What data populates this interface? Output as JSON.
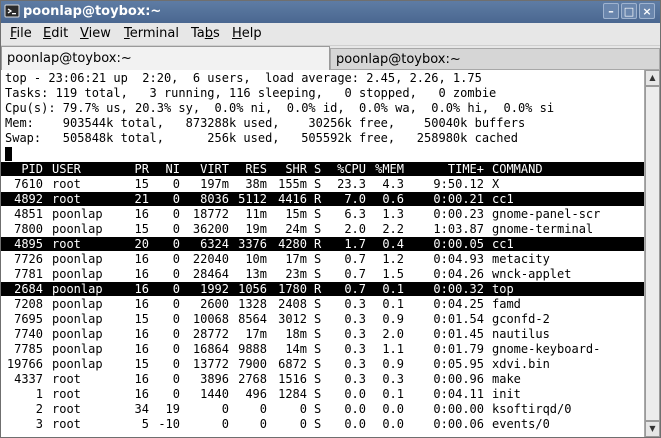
{
  "window": {
    "title": "poonlap@toybox:~",
    "minimize_glyph": "–",
    "maximize_glyph": "□",
    "close_glyph": "×"
  },
  "menu": {
    "file": {
      "label": "File",
      "accel": "F",
      "rest": "ile"
    },
    "edit": {
      "label": "Edit",
      "accel": "E",
      "rest": "dit"
    },
    "view": {
      "label": "View",
      "accel": "V",
      "rest": "iew"
    },
    "terminal": {
      "label": "Terminal",
      "accel": "T",
      "rest": "erminal"
    },
    "tabs": {
      "label": "Tabs",
      "pre": "Ta",
      "accel": "b",
      "rest": "s"
    },
    "help": {
      "label": "Help",
      "accel": "H",
      "rest": "elp"
    }
  },
  "tabs": [
    {
      "label": "poonlap@toybox:~",
      "active": true
    },
    {
      "label": "poonlap@toybox:~",
      "active": false
    }
  ],
  "top": {
    "summary": [
      "top - 23:06:21 up  2:20,  6 users,  load average: 2.45, 2.26, 1.75",
      "Tasks: 119 total,   3 running, 116 sleeping,   0 stopped,   0 zombie",
      "Cpu(s): 79.7% us, 20.3% sy,  0.0% ni,  0.0% id,  0.0% wa,  0.0% hi,  0.0% si",
      "Mem:    903544k total,   873288k used,    30256k free,    50040k buffers",
      "Swap:   505848k total,      256k used,   505592k free,   258980k cached"
    ],
    "columns": [
      "PID",
      "USER",
      "PR",
      "NI",
      "VIRT",
      "RES",
      "SHR",
      "S",
      "%CPU",
      "%MEM",
      "TIME+",
      "COMMAND"
    ],
    "processes": [
      {
        "pid": "7610",
        "user": "root",
        "pr": "15",
        "ni": "0",
        "virt": "197m",
        "res": "38m",
        "shr": "155m",
        "s": "S",
        "cpu": "23.3",
        "mem": "4.3",
        "time": "9:50.12",
        "cmd": "X",
        "hl": false
      },
      {
        "pid": "4892",
        "user": "root",
        "pr": "21",
        "ni": "0",
        "virt": "8036",
        "res": "5112",
        "shr": "4416",
        "s": "R",
        "cpu": "7.0",
        "mem": "0.6",
        "time": "0:00.21",
        "cmd": "cc1",
        "hl": true
      },
      {
        "pid": "4851",
        "user": "poonlap",
        "pr": "16",
        "ni": "0",
        "virt": "18772",
        "res": "11m",
        "shr": "15m",
        "s": "S",
        "cpu": "6.3",
        "mem": "1.3",
        "time": "0:00.23",
        "cmd": "gnome-panel-scr",
        "hl": false
      },
      {
        "pid": "7800",
        "user": "poonlap",
        "pr": "15",
        "ni": "0",
        "virt": "36200",
        "res": "19m",
        "shr": "24m",
        "s": "S",
        "cpu": "2.0",
        "mem": "2.2",
        "time": "1:03.87",
        "cmd": "gnome-terminal",
        "hl": false
      },
      {
        "pid": "4895",
        "user": "root",
        "pr": "20",
        "ni": "0",
        "virt": "6324",
        "res": "3376",
        "shr": "4280",
        "s": "R",
        "cpu": "1.7",
        "mem": "0.4",
        "time": "0:00.05",
        "cmd": "cc1",
        "hl": true
      },
      {
        "pid": "7726",
        "user": "poonlap",
        "pr": "16",
        "ni": "0",
        "virt": "22040",
        "res": "10m",
        "shr": "17m",
        "s": "S",
        "cpu": "0.7",
        "mem": "1.2",
        "time": "0:04.93",
        "cmd": "metacity",
        "hl": false
      },
      {
        "pid": "7781",
        "user": "poonlap",
        "pr": "16",
        "ni": "0",
        "virt": "28464",
        "res": "13m",
        "shr": "23m",
        "s": "S",
        "cpu": "0.7",
        "mem": "1.5",
        "time": "0:04.26",
        "cmd": "wnck-applet",
        "hl": false
      },
      {
        "pid": "2684",
        "user": "poonlap",
        "pr": "16",
        "ni": "0",
        "virt": "1992",
        "res": "1056",
        "shr": "1780",
        "s": "R",
        "cpu": "0.7",
        "mem": "0.1",
        "time": "0:00.32",
        "cmd": "top",
        "hl": true
      },
      {
        "pid": "7208",
        "user": "poonlap",
        "pr": "16",
        "ni": "0",
        "virt": "2600",
        "res": "1328",
        "shr": "2408",
        "s": "S",
        "cpu": "0.3",
        "mem": "0.1",
        "time": "0:04.25",
        "cmd": "famd",
        "hl": false
      },
      {
        "pid": "7695",
        "user": "poonlap",
        "pr": "15",
        "ni": "0",
        "virt": "10068",
        "res": "8564",
        "shr": "3012",
        "s": "S",
        "cpu": "0.3",
        "mem": "0.9",
        "time": "0:01.54",
        "cmd": "gconfd-2",
        "hl": false
      },
      {
        "pid": "7740",
        "user": "poonlap",
        "pr": "16",
        "ni": "0",
        "virt": "28772",
        "res": "17m",
        "shr": "18m",
        "s": "S",
        "cpu": "0.3",
        "mem": "2.0",
        "time": "0:01.45",
        "cmd": "nautilus",
        "hl": false
      },
      {
        "pid": "7785",
        "user": "poonlap",
        "pr": "16",
        "ni": "0",
        "virt": "16864",
        "res": "9888",
        "shr": "14m",
        "s": "S",
        "cpu": "0.3",
        "mem": "1.1",
        "time": "0:01.79",
        "cmd": "gnome-keyboard-",
        "hl": false
      },
      {
        "pid": "19766",
        "user": "poonlap",
        "pr": "15",
        "ni": "0",
        "virt": "13772",
        "res": "7900",
        "shr": "6872",
        "s": "S",
        "cpu": "0.3",
        "mem": "0.9",
        "time": "0:05.95",
        "cmd": "xdvi.bin",
        "hl": false
      },
      {
        "pid": "4337",
        "user": "root",
        "pr": "16",
        "ni": "0",
        "virt": "3896",
        "res": "2768",
        "shr": "1516",
        "s": "S",
        "cpu": "0.3",
        "mem": "0.3",
        "time": "0:00.96",
        "cmd": "make",
        "hl": false
      },
      {
        "pid": "1",
        "user": "root",
        "pr": "16",
        "ni": "0",
        "virt": "1440",
        "res": "496",
        "shr": "1284",
        "s": "S",
        "cpu": "0.0",
        "mem": "0.1",
        "time": "0:04.11",
        "cmd": "init",
        "hl": false
      },
      {
        "pid": "2",
        "user": "root",
        "pr": "34",
        "ni": "19",
        "virt": "0",
        "res": "0",
        "shr": "0",
        "s": "S",
        "cpu": "0.0",
        "mem": "0.0",
        "time": "0:00.00",
        "cmd": "ksoftirqd/0",
        "hl": false
      },
      {
        "pid": "3",
        "user": "root",
        "pr": "5",
        "ni": "-10",
        "virt": "0",
        "res": "0",
        "shr": "0",
        "s": "S",
        "cpu": "0.0",
        "mem": "0.0",
        "time": "0:00.06",
        "cmd": "events/0",
        "hl": false
      }
    ]
  },
  "colors": {
    "titlebar": "#4f6d96",
    "terminal_bg": "#ffffff",
    "terminal_fg": "#000000",
    "highlight_bg": "#000000",
    "highlight_fg": "#ffffff"
  },
  "icons": {
    "app": "terminal-icon",
    "scroll_up": "arrow-up-icon",
    "scroll_down": "arrow-down-icon"
  }
}
